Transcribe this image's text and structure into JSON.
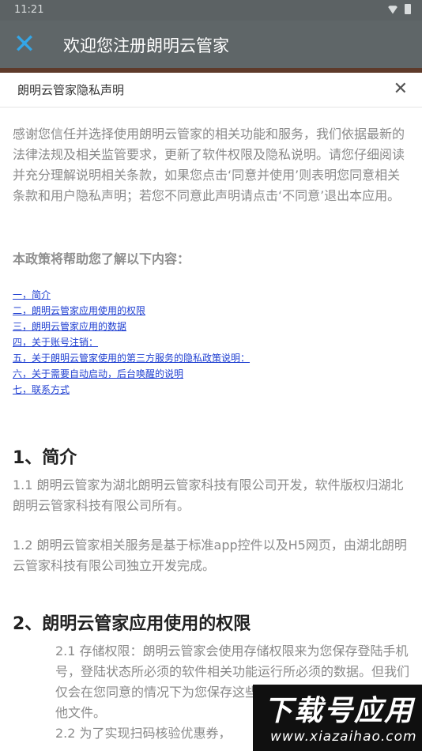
{
  "status_bar": {
    "time": "11:21"
  },
  "appbar": {
    "title": "欢迎您注册朗明云管家",
    "close_icon": "close-icon",
    "accent": "#33a6e8"
  },
  "dialog": {
    "title": "朗明云管家隐私声明",
    "close_glyph": "✕"
  },
  "intro": "感谢您信任并选择使用朗明云管家的相关功能和服务，我们依据最新的法律法规及相关监管要求，更新了软件权限及隐私说明。请您仔细阅读并充分理解说明相关条款，如果您点击‘同意并使用’则表明您同意相关条款和用户隐私声明；若您不同意此声明请点击‘不同意’退出本应用。",
  "subheading": "本政策将帮助您了解以下内容：",
  "toc": [
    "一，简介",
    "二，朗明云管家应用使用的权限",
    "三，朗明云管家应用的数据",
    "四，关于账号注销：",
    "五，关于朗明云管家使用的第三方服务的隐私政策说明：",
    "六，关于需要自动启动，后台唤醒的说明",
    "七，联系方式"
  ],
  "section1": {
    "heading": "1、简介",
    "p1": "1.1 朗明云管家为湖北朗明云管家科技有限公司开发，软件版权归湖北朗明云管家科技有限公司所有。",
    "p2": "1.2 朗明云管家相关服务是基于标准app控件以及H5网页，由湖北朗明云管家科技有限公司独立开发完成。"
  },
  "section2": {
    "heading": "2、朗明云管家应用使用的权限",
    "p1": "2.1 存储权限：朗明云管家会使用存储权限来为您保存登陆手机号，登陆状态所必须的软件相关功能运行所必须的数据。但我们仅会在您同意的情况下为您保存这些数据且不会访问您手机的其他文件。",
    "p2": "2.2 为了实现扫码核验优惠券，"
  },
  "watermark": {
    "line1": "下载号应用",
    "line2": "www.xiazaihao.com"
  }
}
